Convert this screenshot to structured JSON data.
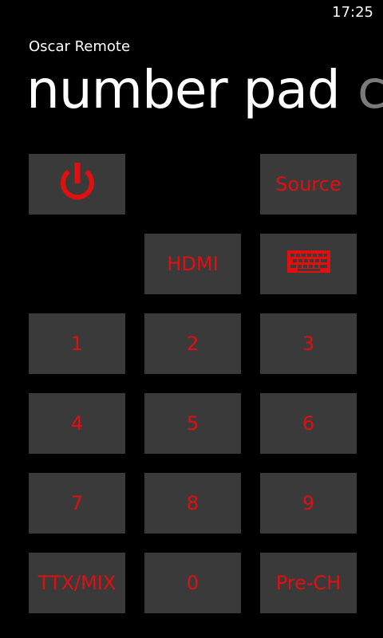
{
  "status_bar": {
    "time": "17:25"
  },
  "app": {
    "title": "Oscar Remote"
  },
  "pivot": {
    "active": "number pad",
    "next": "c"
  },
  "accent_color": "#e01010",
  "tile_color": "#3a3a3a",
  "buttons": {
    "power_icon": "power-icon",
    "source": "Source",
    "hdmi": "HDMI",
    "keyboard_icon": "keyboard-icon",
    "n1": "1",
    "n2": "2",
    "n3": "3",
    "n4": "4",
    "n5": "5",
    "n6": "6",
    "n7": "7",
    "n8": "8",
    "n9": "9",
    "ttx": "TTX/MIX",
    "n0": "0",
    "prech": "Pre-CH"
  }
}
